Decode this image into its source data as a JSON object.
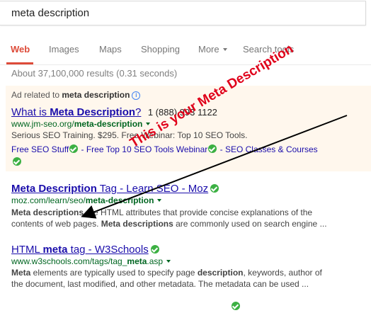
{
  "search": {
    "query": "meta description"
  },
  "tabs": [
    {
      "label": "Web",
      "active": true
    },
    {
      "label": "Images"
    },
    {
      "label": "Maps"
    },
    {
      "label": "Shopping"
    },
    {
      "label": "More"
    },
    {
      "label": "Search tools"
    }
  ],
  "stats": "About 37,100,000 results (0.31 seconds)",
  "ad": {
    "label_prefix": "Ad related to ",
    "label_query": "meta description",
    "title_a": "What is ",
    "title_b": "Meta Description",
    "title_c": "?",
    "phone": "1 (888) 993 1122",
    "url_a": "www.jm-seo.org/",
    "url_b": "meta-description",
    "snippet": "Serious SEO Training. $295. Free Webinar: Top 10 SEO Tools.",
    "sitelinks": [
      "Free SEO Stuff",
      "Free Top 10 SEO Tools Webinar",
      "SEO Classes & Courses"
    ],
    "separator": " - "
  },
  "results": [
    {
      "title_a": "Meta Description",
      "title_b": " Tag - Learn SEO - Moz",
      "url_a": "moz.com/learn/seo/",
      "url_b": "meta-description",
      "snippet_1a": "Meta descriptions",
      "snippet_1b": " are HTML attributes that provide concise explanations of the",
      "snippet_2a": "contents of web pages. ",
      "snippet_2b": "Meta descriptions",
      "snippet_2c": " are commonly used on search engine ..."
    },
    {
      "title_a": "HTML ",
      "title_b": "meta",
      "title_c": " tag - W3Schools",
      "url_a": "www.w3schools.com/tags/tag_",
      "url_b": "meta",
      "url_c": ".asp",
      "snippet_1a": "Meta",
      "snippet_1b": " elements are typically used to specify page ",
      "snippet_1c": "description",
      "snippet_1d": ", keywords, author of",
      "snippet_2a": "the document, last modified, and other metadata. The metadata can be used ..."
    }
  ],
  "annotation": {
    "text": "This is your Meta Description",
    "color": "#e0001a"
  },
  "colors": {
    "link": "#1a0dab",
    "url": "#006621",
    "accent": "#dd4b39",
    "ad_bg": "#fff7ed"
  }
}
